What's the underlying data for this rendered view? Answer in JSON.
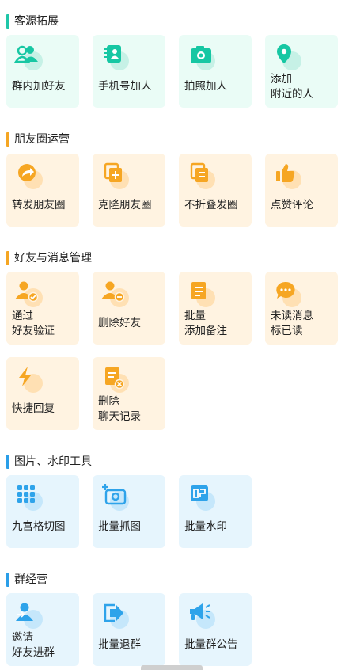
{
  "sections": [
    {
      "title": "客源拓展",
      "accent": "#1fc6a8",
      "items": [
        {
          "label": "群内加好友",
          "icon": "group-users-icon"
        },
        {
          "label": "手机号加人",
          "icon": "phone-contacts-icon"
        },
        {
          "label": "拍照加人",
          "icon": "camera-icon"
        },
        {
          "label": "添加\n附近的人",
          "icon": "location-pin-icon"
        }
      ]
    },
    {
      "title": "朋友圈运营",
      "accent": "#f5a623",
      "items": [
        {
          "label": "转发朋友圈",
          "icon": "share-arrow-icon"
        },
        {
          "label": "克隆朋友圈",
          "icon": "clone-copy-icon"
        },
        {
          "label": "不折叠发圈",
          "icon": "unfold-post-icon"
        },
        {
          "label": "点赞评论",
          "icon": "thumbs-up-icon"
        }
      ]
    },
    {
      "title": "好友与消息管理",
      "accent": "#f5a623",
      "items": [
        {
          "label": "通过\n好友验证",
          "icon": "user-verify-icon"
        },
        {
          "label": "删除好友",
          "icon": "user-remove-icon"
        },
        {
          "label": "批量\n添加备注",
          "icon": "note-list-icon"
        },
        {
          "label": "未读消息\n标已读",
          "icon": "chat-bubble-icon"
        },
        {
          "label": "快捷回复",
          "icon": "lightning-icon"
        },
        {
          "label": "删除\n聊天记录",
          "icon": "delete-history-icon"
        }
      ]
    },
    {
      "title": "图片、水印工具",
      "accent": "#2a9ee8",
      "items": [
        {
          "label": "九宫格切图",
          "icon": "grid-nine-icon"
        },
        {
          "label": "批量抓图",
          "icon": "camera-add-icon"
        },
        {
          "label": "批量水印",
          "icon": "stamp-icon"
        }
      ]
    },
    {
      "title": "群经营",
      "accent": "#2a9ee8",
      "items": [
        {
          "label": "邀请\n好友进群",
          "icon": "invite-user-icon"
        },
        {
          "label": "批量退群",
          "icon": "exit-group-icon"
        },
        {
          "label": "批量群公告",
          "icon": "megaphone-icon"
        }
      ]
    }
  ],
  "colors": {
    "teal_icon": "#17c7a3",
    "teal_bg": "#eafcf6",
    "orange_icon": "#f6a623",
    "peach_bg": "#fff3e1",
    "blue_icon": "#2ea3ea",
    "blue_bg": "#e6f5fd"
  }
}
